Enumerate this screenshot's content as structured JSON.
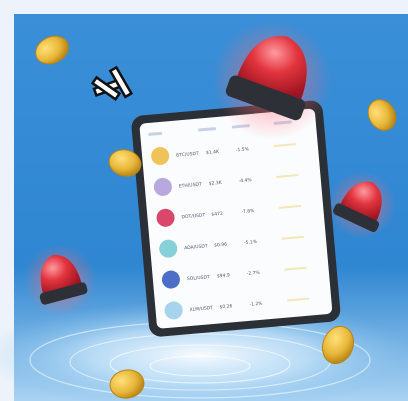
{
  "image": {
    "subject": "tablet-with-crypto-list-and-alarm-lights",
    "tablet": {
      "rows": [
        {
          "coin_color": "#f0c35a",
          "name": "BTC/USDT",
          "price": "$1.4K",
          "change": "-1.5%"
        },
        {
          "coin_color": "#b9a8de",
          "name": "ETH/USDT",
          "price": "$2.3K",
          "change": "-4.4%"
        },
        {
          "coin_color": "#d9476b",
          "name": "DOT/USDT",
          "price": "$472",
          "change": "-7.8%"
        },
        {
          "coin_color": "#86d0d9",
          "name": "ADA/USDT",
          "price": "$0.96",
          "change": "-5.1%"
        },
        {
          "coin_color": "#4d6ec8",
          "name": "SOL/USDT",
          "price": "$94.9",
          "change": "-2.7%"
        },
        {
          "coin_color": "#a6d4ee",
          "name": "XLM/USDT",
          "price": "$0.26",
          "change": "-1.2%"
        }
      ]
    },
    "colors": {
      "background_sky": "#3b8ed6",
      "background_light": "#eef3fb",
      "coin": "#e8b83a",
      "alarm_red": "#e2353f",
      "tablet_body": "#2b2f36",
      "tablet_screen": "#fbfcfe"
    }
  }
}
